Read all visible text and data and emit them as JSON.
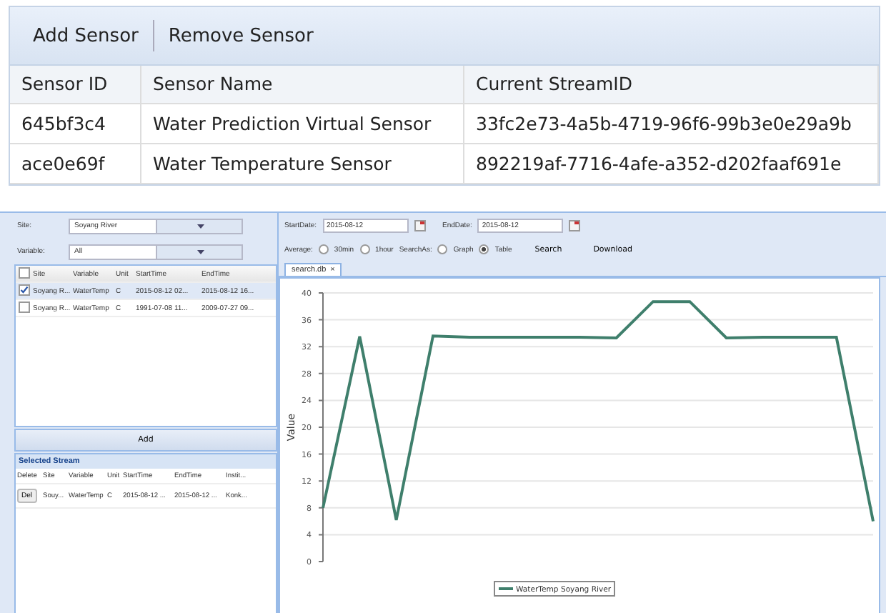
{
  "sensor_toolbar": {
    "buttons": [
      "Add Sensor",
      "Remove Sensor"
    ]
  },
  "sensor_table": {
    "columns": [
      "Sensor ID",
      "Sensor Name",
      "Current StreamID"
    ],
    "rows": [
      [
        "645bf3c4",
        "Water Prediction Virtual Sensor",
        "33fc2e73-4a5b-4719-96f6-99b3e0e29a9b"
      ],
      [
        "ace0e69f",
        "Water Temperature Sensor",
        "892219af-7716-4afe-a352-d202faaf691e"
      ]
    ]
  },
  "filters": {
    "site_label": "Site:",
    "site_value": "Soyang River",
    "variable_label": "Variable:",
    "variable_value": "All"
  },
  "stream_grid": {
    "select_all_checked": false,
    "columns": [
      "Site",
      "Variable",
      "Unit",
      "StartTime",
      "EndTime"
    ],
    "rows": [
      {
        "checked": true,
        "cells": [
          "Soyang R...",
          "WaterTemp",
          "C",
          "2015-08-12 02...",
          "2015-08-12 16..."
        ]
      },
      {
        "checked": false,
        "cells": [
          "Soyang R...",
          "WaterTemp",
          "C",
          "1991-07-08 11...",
          "2009-07-27 09..."
        ]
      }
    ]
  },
  "add_button": "Add",
  "selected_stream": {
    "title": "Selected Stream",
    "columns": [
      "Delete",
      "Site",
      "Variable",
      "Unit",
      "StartTime",
      "EndTime",
      "Instit..."
    ],
    "rows": [
      {
        "cells": [
          "Del",
          "Souy...",
          "WaterTemp",
          "C",
          "2015-08-12 ...",
          "2015-08-12 ...",
          "Konk..."
        ]
      }
    ]
  },
  "query": {
    "start_label": "StartDate:",
    "start_value": "2015-08-12",
    "end_label": "EndDate:",
    "end_value": "2015-08-12",
    "average_label": "Average:",
    "average_options": [
      {
        "label": "30min",
        "selected": false
      },
      {
        "label": "1hour",
        "selected": false
      }
    ],
    "search_as_label": "SearchAs:",
    "search_as_options": [
      {
        "label": "Graph",
        "selected": false
      },
      {
        "label": "Table",
        "selected": true
      }
    ],
    "buttons": [
      "Search",
      "Download"
    ]
  },
  "tabs": [
    {
      "label": "search.db",
      "close": "×",
      "selected": true
    }
  ],
  "chart_data": {
    "type": "line",
    "grid": true,
    "ylabel": "Value",
    "ylim": [
      0,
      40
    ],
    "yticks": [
      0,
      4,
      8,
      12,
      16,
      20,
      24,
      28,
      32,
      36,
      40
    ],
    "series": [
      {
        "name": "WaterTemp Soyang River",
        "color": "#3f7f6c",
        "values": [
          8,
          33.5,
          6.2,
          33.6,
          33.4,
          33.4,
          33.4,
          33.4,
          33.3,
          38.7,
          38.7,
          33.3,
          33.4,
          33.4,
          33.4,
          6
        ]
      }
    ]
  }
}
